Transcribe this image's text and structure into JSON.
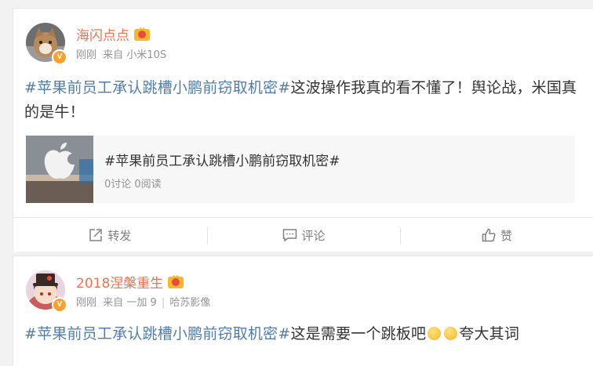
{
  "posts": [
    {
      "username": "海闪点点",
      "time": "刚刚",
      "source_prefix": "来自",
      "source": "小米10S",
      "hashtag": "#苹果前员工承认跳槽小鹏前窃取机密#",
      "text": "这波操作我真的看不懂了！舆论战，米国真的是牛！",
      "topic": {
        "title": "#苹果前员工承认跳槽小鹏前窃取机密#",
        "stats": "0讨论 0阅读"
      },
      "actions": {
        "repost": "转发",
        "comment": "评论",
        "like": "赞"
      }
    },
    {
      "username": "2018涅槃重生",
      "time": "刚刚",
      "source_prefix": "来自",
      "source": "一加 9",
      "separator": "|",
      "location": "哈苏影像",
      "hashtag": "#苹果前员工承认跳槽小鹏前窃取机密#",
      "text_a": "这是需要一个跳板吧",
      "text_b": "夸大其词"
    }
  ],
  "colors": {
    "username": "#eb7350",
    "hashtag": "#507daf",
    "meta": "#939393",
    "verified_badge": "#f7a12a"
  },
  "icons": [
    "crown-icon",
    "verified-badge-icon",
    "repost-icon",
    "comment-icon",
    "like-icon",
    "thinking-emoji-icon"
  ]
}
